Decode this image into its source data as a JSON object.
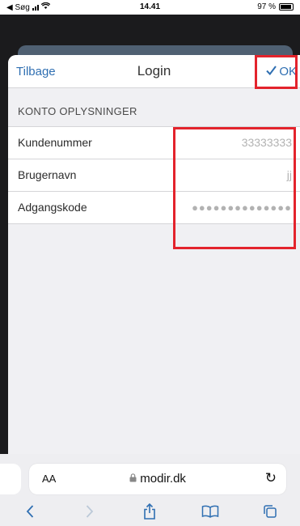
{
  "statusbar": {
    "back_app": "◀ Søg",
    "time": "14.41",
    "battery": "97 %"
  },
  "navbar": {
    "back_label": "Tilbage",
    "title": "Login",
    "ok_label": "OK"
  },
  "section": {
    "header": "KONTO OPLYSNINGER"
  },
  "fields": [
    {
      "label": "Kundenummer",
      "value": "33333333"
    },
    {
      "label": "Brugernavn",
      "value": "jj"
    },
    {
      "label": "Adgangskode",
      "value": "●●●●●●●●●●●●●●"
    }
  ],
  "browser": {
    "text_size_label": "AA",
    "url": "modir.dk"
  },
  "colors": {
    "accent": "#2f6fb2",
    "highlight": "#e3232c"
  }
}
